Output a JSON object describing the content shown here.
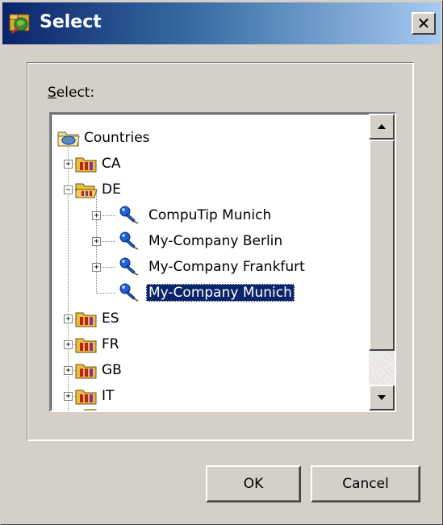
{
  "window": {
    "title": "Select",
    "close_label": "✕"
  },
  "dialog": {
    "label": "Select:",
    "label_accel": "S",
    "label_rest": "elect:",
    "ok_label": "OK",
    "cancel_label": "Cancel"
  },
  "tree": {
    "root": "Countries",
    "nodes": [
      {
        "label": "CA",
        "expander": "+"
      },
      {
        "label": "DE",
        "expander": "−"
      },
      {
        "label": "CompuTip Munich",
        "expander": "+"
      },
      {
        "label": "My-Company Berlin",
        "expander": "+"
      },
      {
        "label": "My-Company Frankfurt",
        "expander": "+"
      },
      {
        "label": "My-Company Munich",
        "selected": true
      },
      {
        "label": "ES",
        "expander": "+"
      },
      {
        "label": "FR",
        "expander": "+"
      },
      {
        "label": "GB",
        "expander": "+"
      },
      {
        "label": "IT",
        "expander": "+"
      }
    ]
  },
  "colors": {
    "title_bar_start": "#0a246a",
    "title_bar_end": "#a6caf0",
    "selection": "#0a246a",
    "face": "#d4d0c8"
  },
  "icons": {
    "title": "app-icon",
    "root": "globe-folder-icon",
    "country": "country-folder-icon",
    "open_country": "open-folder-icon",
    "company": "pushpin-icon"
  }
}
